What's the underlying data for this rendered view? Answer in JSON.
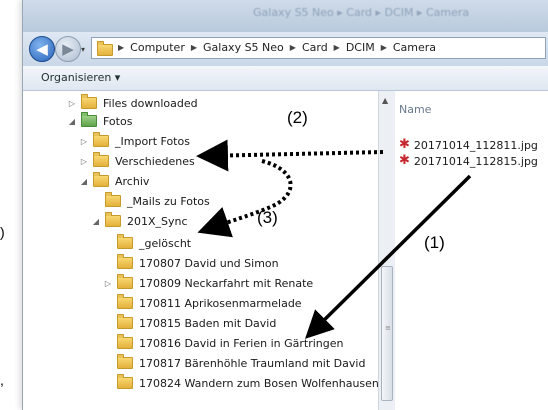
{
  "window": {
    "title": "Galaxy S5 Neo ▸ Card ▸ DCIM ▸ Camera"
  },
  "address_bar": {
    "crumbs": [
      "Computer",
      "Galaxy S5 Neo",
      "Card",
      "DCIM",
      "Camera"
    ]
  },
  "toolbar": {
    "organize_label": "Organisieren ▾"
  },
  "nav_tree": [
    {
      "label": "Files downloaded",
      "expander": "▷",
      "green": false
    },
    {
      "label": "Fotos",
      "expander": "◢",
      "green": true
    },
    {
      "label": "_Import Fotos",
      "expander": "▷",
      "green": false
    },
    {
      "label": "Verschiedenes",
      "expander": "▷",
      "green": false
    },
    {
      "label": "Archiv",
      "expander": "◢",
      "green": false
    },
    {
      "label": "_Mails zu Fotos",
      "expander": "",
      "green": false
    },
    {
      "label": "201X_Sync",
      "expander": "◢",
      "green": false
    },
    {
      "label": "_gelöscht",
      "expander": "",
      "green": false
    },
    {
      "label": "170807 David und Simon",
      "expander": "",
      "green": false
    },
    {
      "label": "170809 Neckarfahrt mit Renate",
      "expander": "▷",
      "green": false
    },
    {
      "label": "170811 Aprikosenmarmelade",
      "expander": "",
      "green": false
    },
    {
      "label": "170815 Baden mit David",
      "expander": "",
      "green": false
    },
    {
      "label": "170816 David in Ferien in Gärtringen",
      "expander": "",
      "green": false
    },
    {
      "label": "170817 Bärenhöhle Traumland mit David",
      "expander": "",
      "green": false
    },
    {
      "label": "170824 Wandern zum Bosen Wolfenhausen",
      "expander": "",
      "green": false
    }
  ],
  "file_list": {
    "column_header": "Name",
    "files": [
      "20171014_112811.jpg",
      "20171014_112815.jpg"
    ]
  },
  "annotations": {
    "a1": "(1)",
    "a2": "(2)",
    "a3": "(3)",
    "edge_paren": ")",
    "edge_comma": ","
  },
  "colors": {
    "arrow": "#000000",
    "window_chrome": "#c9d7e7",
    "folder": "#e4b13c"
  }
}
